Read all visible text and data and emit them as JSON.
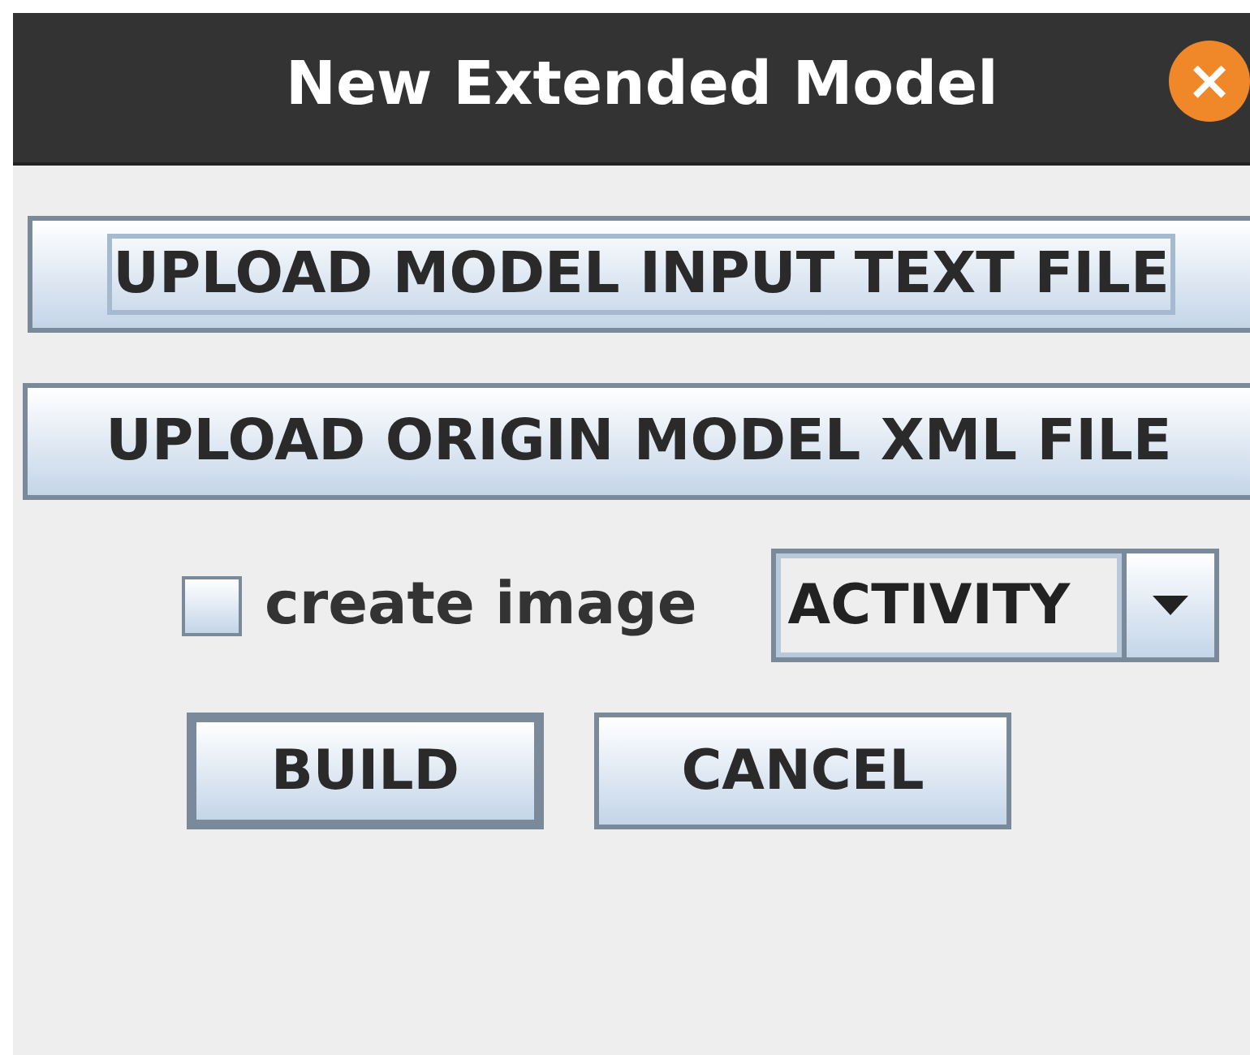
{
  "window": {
    "title": "New Extended Model",
    "close": "×"
  },
  "upload_buttons": [
    {
      "label": "UPLOAD MODEL INPUT TEXT FILE",
      "focused": true
    },
    {
      "label": "UPLOAD ORIGIN MODEL XML FILE",
      "focused": false
    }
  ],
  "create_image": {
    "label": "create image",
    "checked": false
  },
  "type_dropdown": {
    "value": "ACTIVITY"
  },
  "buttons": [
    {
      "label": "BUILD",
      "default": true
    },
    {
      "label": "CANCEL",
      "default": false
    }
  ]
}
